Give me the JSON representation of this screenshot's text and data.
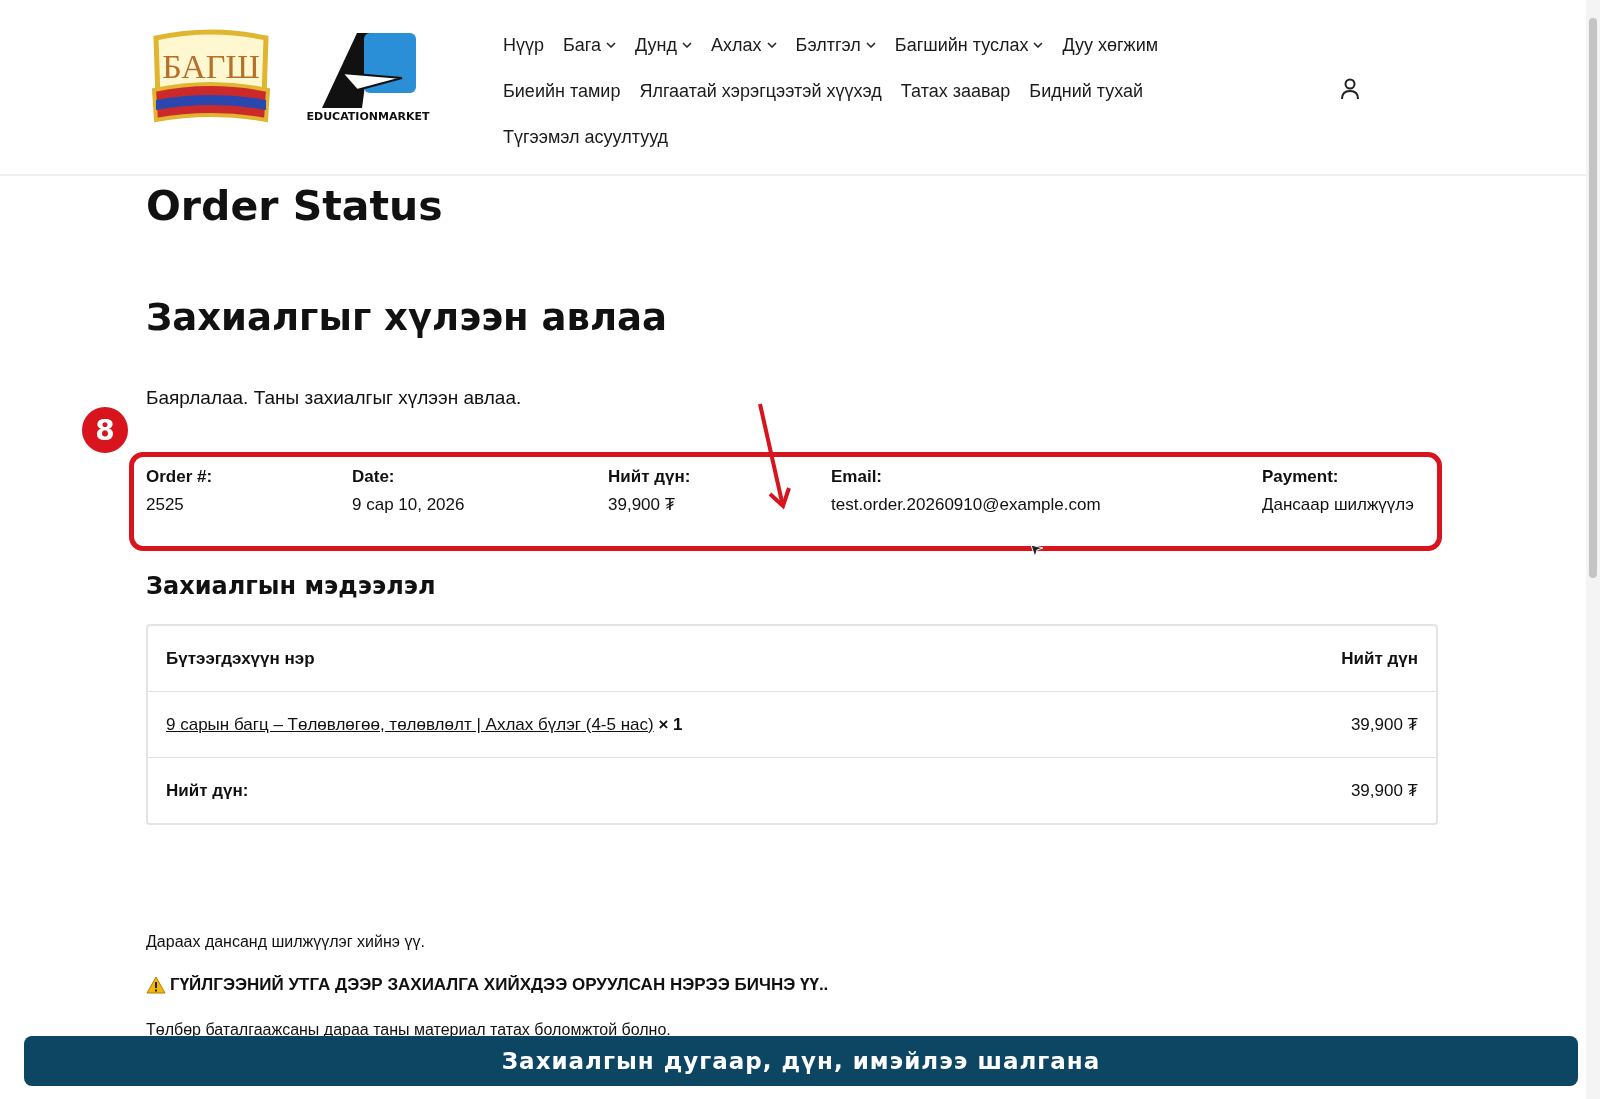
{
  "logos": [
    {
      "text": "БАГШ"
    },
    {
      "text": "EDUCATIONMARKET"
    }
  ],
  "nav": [
    {
      "label": "Нүүр",
      "dropdown": false
    },
    {
      "label": "Бага",
      "dropdown": true
    },
    {
      "label": "Дунд",
      "dropdown": true
    },
    {
      "label": "Ахлах",
      "dropdown": true
    },
    {
      "label": "Бэлтгэл",
      "dropdown": true
    },
    {
      "label": "Багшийн туслах",
      "dropdown": true
    },
    {
      "label": "Дуу хөгжим",
      "dropdown": false
    },
    {
      "label": "Биеийн тамир",
      "dropdown": false
    },
    {
      "label": "Ялгаатай хэрэгцээтэй хүүхэд",
      "dropdown": false
    },
    {
      "label": "Татах заавар",
      "dropdown": false
    },
    {
      "label": "Бидний тухай",
      "dropdown": false
    },
    {
      "label": "Түгээмэл асуултууд",
      "dropdown": false
    }
  ],
  "page_title": "Order Status",
  "heading": "Захиалгыг хүлээн авлаа",
  "thank_you": "Баярлалаа. Таны захиалгыг хүлээн авлаа.",
  "order_overview": [
    {
      "label": "Order #:",
      "value": "2525"
    },
    {
      "label": "Date:",
      "value": "9 сар 10, 2026"
    },
    {
      "label": "Нийт дүн:",
      "value": "39,900 ₮"
    },
    {
      "label": "Email:",
      "value": "test.order.20260910@example.com"
    },
    {
      "label": "Payment:",
      "value": "Дансаар шилжүүлэ"
    }
  ],
  "details_title": "Захиалгын мэдээлэл",
  "table": {
    "columns": [
      "Бүтээгдэхүүн нэр",
      "Нийт дүн"
    ],
    "rows": [
      {
        "product": "9 сарын багц – Төлөвлөгөө, төлөвлөлт | Ахлах бүлэг (4-5 нас)",
        "quantity": "× 1",
        "total": "39,900 ₮"
      }
    ],
    "footer": {
      "label": "Нийт дүн:",
      "value": "39,900 ₮"
    }
  },
  "instruction": "Дараах дансанд шилжүүлэг хийнэ үү.",
  "warning": "ГҮЙЛГЭЭНИЙ УТГА ДЭЭР ЗАХИАЛГА ХИЙХДЭЭ ОРУУЛСАН НЭРЭЭ БИЧНЭ ҮҮ..",
  "note": "Төлбөр баталгаажсаны дараа таны материал татах боломжтой болно.",
  "annotation": {
    "badge": "8",
    "caption": "Захиалгын дугаар, дүн, имэйлээ шалгана"
  }
}
